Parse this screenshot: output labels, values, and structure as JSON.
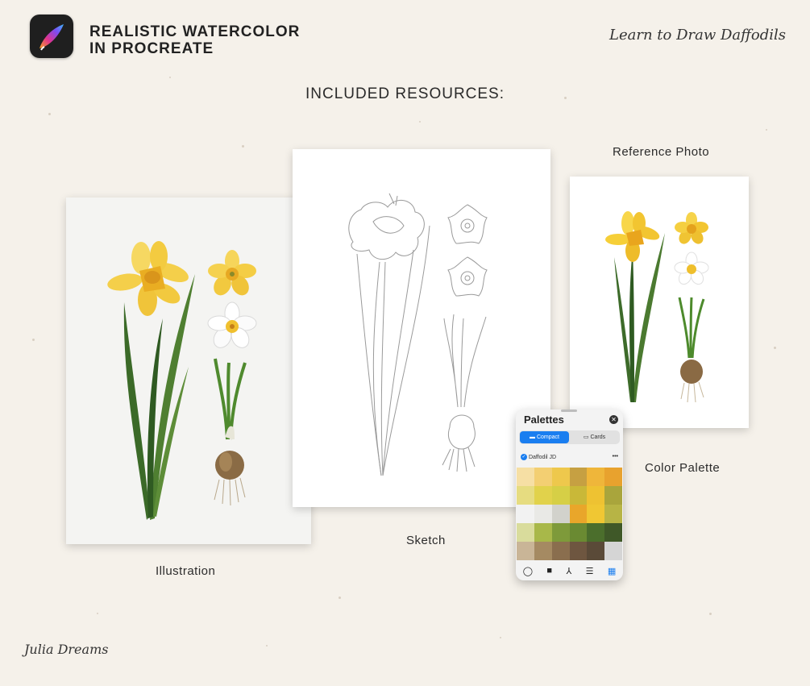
{
  "header": {
    "title_line1": "REALISTIC WATERCOLOR",
    "title_line2": "IN PROCREATE",
    "tagline": "Learn to Draw Daffodils"
  },
  "resources_heading": "INCLUDED RESOURCES:",
  "items": {
    "illustration": "Illustration",
    "sketch": "Sketch",
    "reference_photo": "Reference Photo",
    "color_palette": "Color Palette"
  },
  "palette_panel": {
    "title": "Palettes",
    "close_icon": "x-circle-icon",
    "tab_compact": "Compact",
    "tab_cards": "Cards",
    "palette_name": "Daffodil JD",
    "more": "•••",
    "swatches": [
      "#f6dfa4",
      "#f3cf72",
      "#eec84c",
      "#c6a042",
      "#efb63a",
      "#e8a22e",
      "#e6dc80",
      "#e1d24b",
      "#d6cf46",
      "#c9b838",
      "#eec232",
      "#a9a53c",
      "#f2f2f2",
      "#e9e9e6",
      "#d2d2cc",
      "#e9a62a",
      "#f0c733",
      "#b7b445",
      "#d9dc9c",
      "#a8b849",
      "#7e9a3a",
      "#6a8a32",
      "#4b6e2c",
      "#3f5828",
      "#c9b597",
      "#a58a62",
      "#8a6e4e",
      "#6e5640",
      "#5a4a38",
      "#d5d5d5"
    ]
  },
  "signature": "Julia Dreams",
  "colors": {
    "background": "#f5f1ea",
    "accent_blue": "#1a7ef0",
    "daffodil_yellow": "#f2c531",
    "leaf_green": "#3f6f2a"
  }
}
